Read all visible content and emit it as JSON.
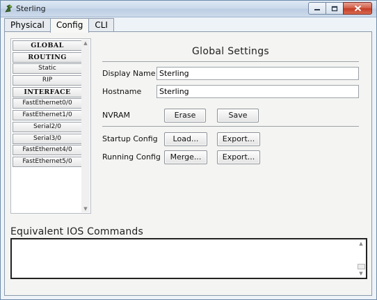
{
  "window": {
    "title": "Sterling"
  },
  "tabs": [
    {
      "label": "Physical",
      "active": false
    },
    {
      "label": "Config",
      "active": true
    },
    {
      "label": "CLI",
      "active": false
    }
  ],
  "nav": {
    "items": [
      {
        "label": "GLOBAL",
        "header": true
      },
      {
        "label": "ROUTING",
        "header": true
      },
      {
        "label": "Static",
        "header": false
      },
      {
        "label": "RIP",
        "header": false
      },
      {
        "label": "INTERFACE",
        "header": true
      },
      {
        "label": "FastEthernet0/0",
        "header": false
      },
      {
        "label": "FastEthernet1/0",
        "header": false
      },
      {
        "label": "Serial2/0",
        "header": false
      },
      {
        "label": "Serial3/0",
        "header": false
      },
      {
        "label": "FastEthernet4/0",
        "header": false
      },
      {
        "label": "FastEthernet5/0",
        "header": false
      }
    ]
  },
  "global_settings": {
    "title": "Global Settings",
    "display_name_label": "Display Name",
    "display_name_value": "Sterling",
    "hostname_label": "Hostname",
    "hostname_value": "Sterling",
    "nvram_label": "NVRAM",
    "erase_label": "Erase",
    "save_label": "Save",
    "startup_label": "Startup Config",
    "load_label": "Load...",
    "startup_export_label": "Export...",
    "running_label": "Running Config",
    "merge_label": "Merge...",
    "running_export_label": "Export..."
  },
  "ios": {
    "title": "Equivalent IOS Commands",
    "content": ""
  },
  "colors": {
    "title_gradient": "#c9d8ea",
    "close_button": "#c23b24",
    "console_border": "#222222"
  },
  "icons": [
    "app-icon",
    "minimize-icon",
    "maximize-icon",
    "close-icon",
    "scroll-up-icon",
    "scroll-down-icon"
  ]
}
